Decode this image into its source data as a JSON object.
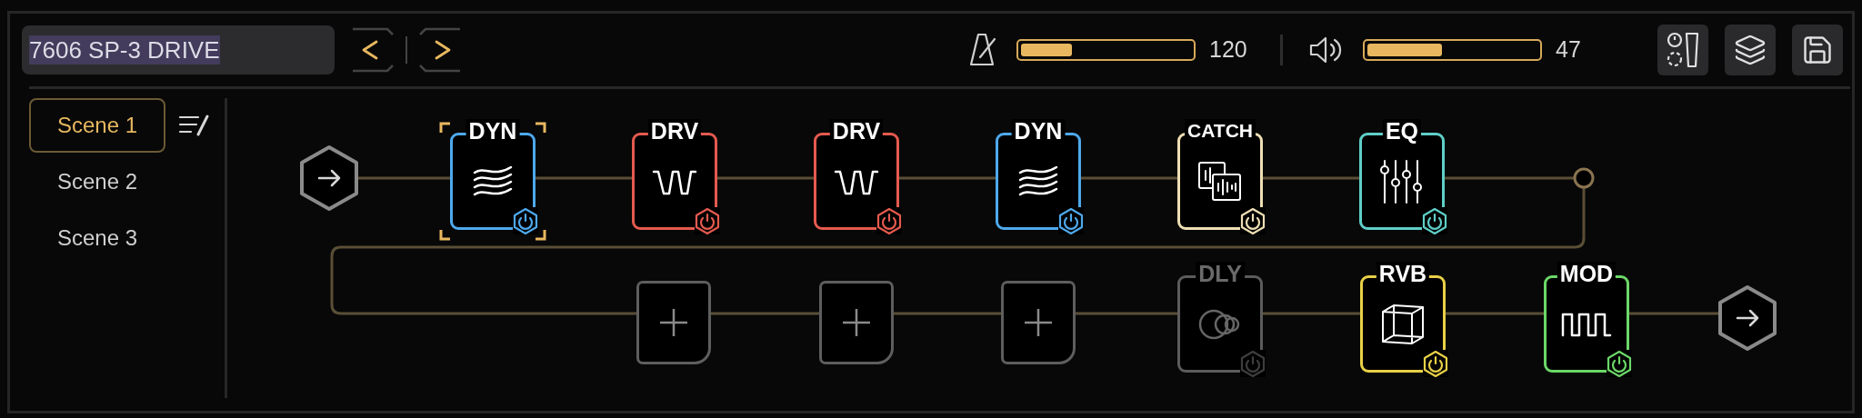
{
  "preset": {
    "name": "7606 SP-3 DRIVE"
  },
  "tempo": {
    "level": 0.3,
    "reading": "120"
  },
  "volume": {
    "level": 0.44,
    "reading": "47"
  },
  "scenes": [
    {
      "label": "Scene 1",
      "selected": true
    },
    {
      "label": "Scene 2",
      "selected": false
    },
    {
      "label": "Scene 3",
      "selected": false
    }
  ],
  "chain": {
    "rows": [
      {
        "blocks": [
          {
            "kind": "dynamics",
            "label": "DYN",
            "color": "#4ea9ec",
            "on": true,
            "selected": true
          },
          {
            "kind": "drive",
            "label": "DRV",
            "color": "#e55a4f",
            "on": true,
            "selected": false
          },
          {
            "kind": "drive",
            "label": "DRV",
            "color": "#e55a4f",
            "on": true,
            "selected": false
          },
          {
            "kind": "dynamics",
            "label": "DYN",
            "color": "#4ea9ec",
            "on": true,
            "selected": false
          },
          {
            "kind": "capture",
            "label": "CATCH",
            "color": "#eedfb4",
            "on": true,
            "selected": false
          },
          {
            "kind": "eq",
            "label": "EQ",
            "color": "#5fcfc8",
            "on": true,
            "selected": false
          }
        ]
      },
      {
        "blocks": [
          {
            "kind": "empty",
            "selected": false
          },
          {
            "kind": "empty",
            "selected": false
          },
          {
            "kind": "empty",
            "selected": false
          },
          {
            "kind": "delay",
            "label": "DLY",
            "color": "#5c5c5c",
            "on": false,
            "selected": false
          },
          {
            "kind": "reverb",
            "label": "RVB",
            "color": "#e8d048",
            "on": true,
            "selected": false
          },
          {
            "kind": "modulation",
            "label": "MOD",
            "color": "#6cd868",
            "on": true,
            "selected": false
          }
        ]
      }
    ]
  }
}
